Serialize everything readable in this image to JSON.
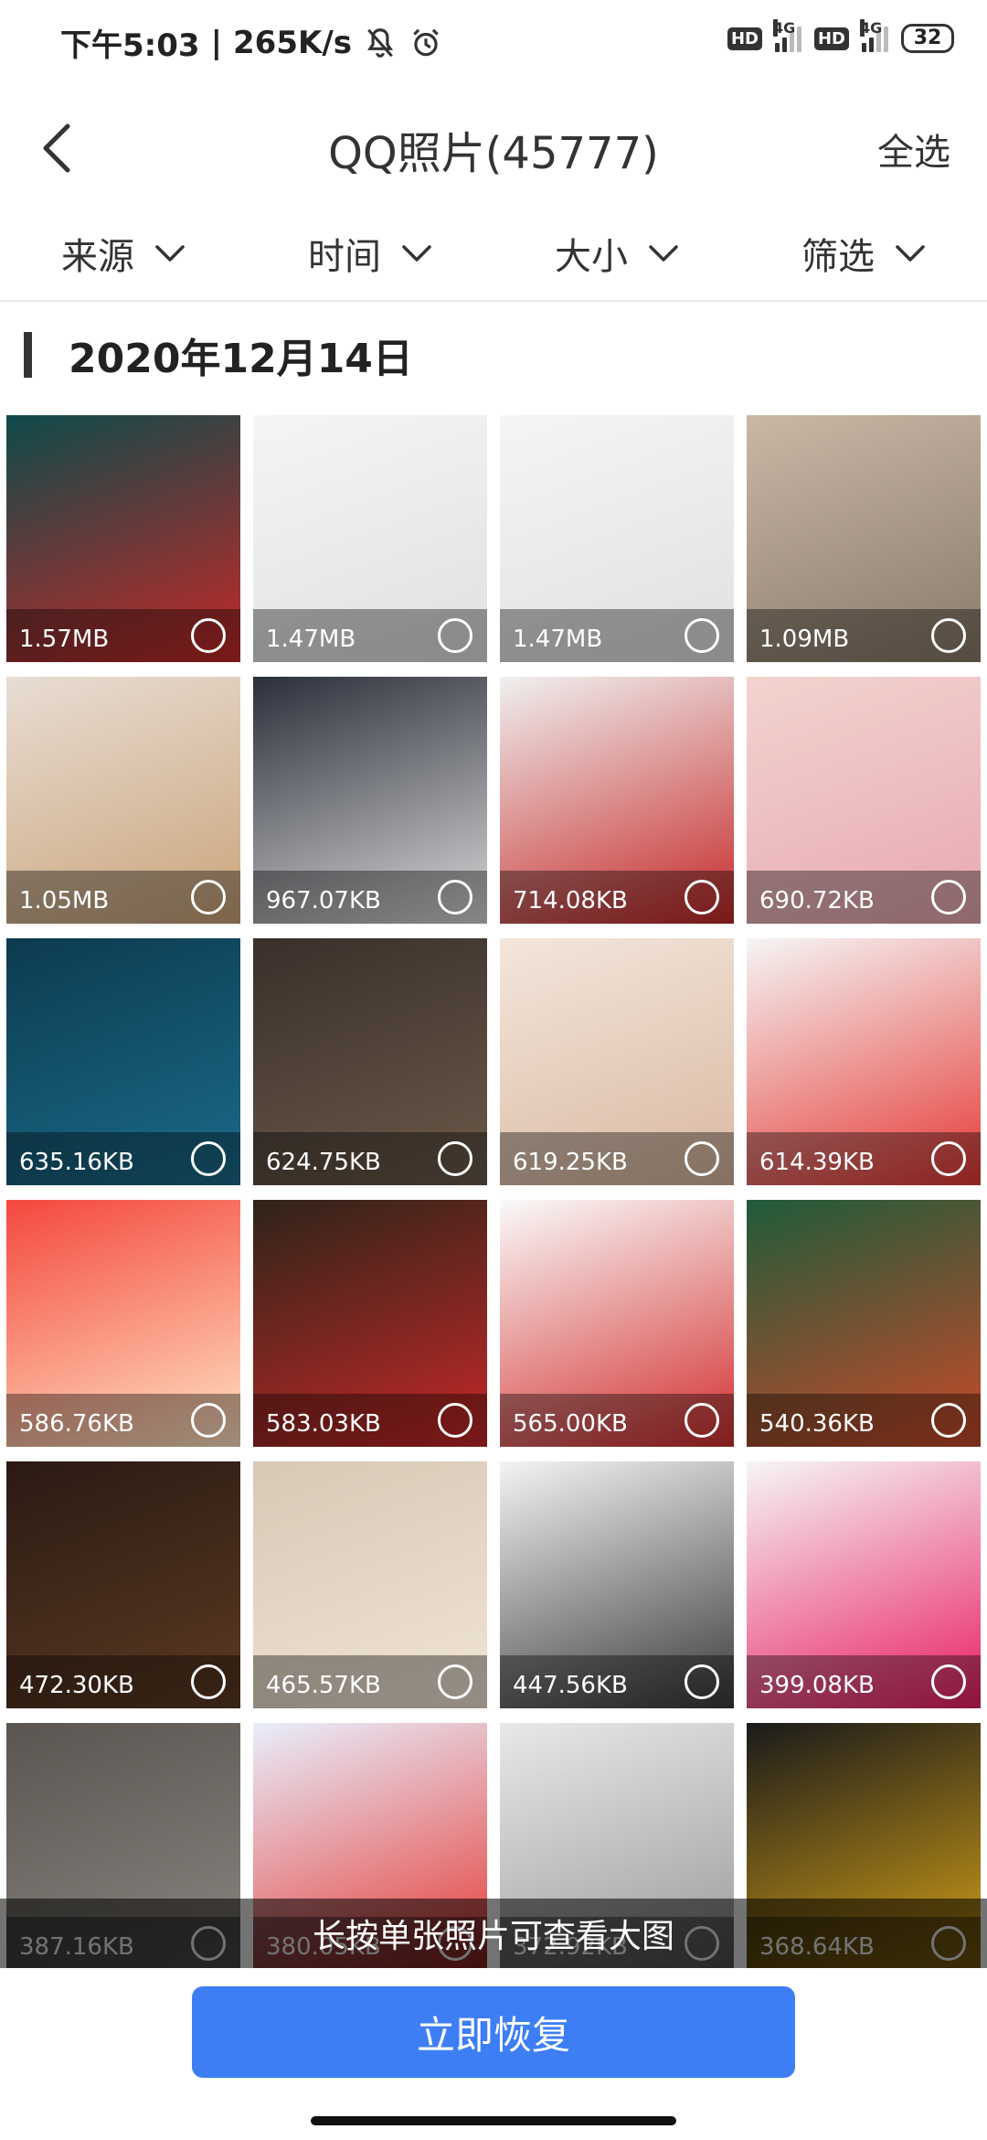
{
  "status_bar": {
    "time": "下午5:03",
    "separator": "|",
    "speed": "265K/s",
    "hd1": "HD",
    "sig1": "4G",
    "hd2": "HD",
    "sig2": "4G",
    "battery": "32"
  },
  "header": {
    "title": "QQ照片(45777)",
    "select_all": "全选"
  },
  "filters": [
    {
      "label": "来源"
    },
    {
      "label": "时间"
    },
    {
      "label": "大小"
    },
    {
      "label": "筛选"
    }
  ],
  "date_header": "2020年12月14日",
  "photos": [
    {
      "size": "1.57MB",
      "colors": [
        "#0e4a4a",
        "#c62828"
      ]
    },
    {
      "size": "1.47MB",
      "colors": [
        "#f5f5f5",
        "#e0e0e0"
      ]
    },
    {
      "size": "1.47MB",
      "colors": [
        "#f5f5f5",
        "#e0e0e0"
      ]
    },
    {
      "size": "1.09MB",
      "colors": [
        "#c9b8a6",
        "#8a7a6a"
      ]
    },
    {
      "size": "1.05MB",
      "colors": [
        "#e8ddd4",
        "#caa47a"
      ]
    },
    {
      "size": "967.07KB",
      "colors": [
        "#2b2f3a",
        "#d9d9d9"
      ]
    },
    {
      "size": "714.08KB",
      "colors": [
        "#f0f0f0",
        "#c62828"
      ]
    },
    {
      "size": "690.72KB",
      "colors": [
        "#f2d4cf",
        "#e8a8b0"
      ]
    },
    {
      "size": "635.16KB",
      "colors": [
        "#0d3b4f",
        "#1a6b8a"
      ]
    },
    {
      "size": "624.75KB",
      "colors": [
        "#3a2f2a",
        "#6b5a4a"
      ]
    },
    {
      "size": "619.25KB",
      "colors": [
        "#f3e6dc",
        "#d9b8a0"
      ]
    },
    {
      "size": "614.39KB",
      "colors": [
        "#f5f5f5",
        "#e53935"
      ]
    },
    {
      "size": "586.76KB",
      "colors": [
        "#f4473e",
        "#ffe3c2"
      ]
    },
    {
      "size": "583.03KB",
      "colors": [
        "#2e2419",
        "#c62828"
      ]
    },
    {
      "size": "565.00KB",
      "colors": [
        "#fafafa",
        "#d32f2f"
      ]
    },
    {
      "size": "540.36KB",
      "colors": [
        "#1f5b3a",
        "#c94a2a"
      ]
    },
    {
      "size": "472.30KB",
      "colors": [
        "#2a1a14",
        "#5c3a22"
      ]
    },
    {
      "size": "465.57KB",
      "colors": [
        "#d8c9b6",
        "#f0e4d4"
      ]
    },
    {
      "size": "447.56KB",
      "colors": [
        "#f4f4f4",
        "#3a3a3a"
      ]
    },
    {
      "size": "399.08KB",
      "colors": [
        "#f6f6f6",
        "#e91e63"
      ]
    },
    {
      "size": "387.16KB",
      "colors": [
        "#5a5550",
        "#8a8580"
      ]
    },
    {
      "size": "380.05KB",
      "colors": [
        "#e8eefc",
        "#e53935"
      ]
    },
    {
      "size": "372.92KB",
      "colors": [
        "#e8e8e8",
        "#9a9a9a"
      ]
    },
    {
      "size": "368.64KB",
      "colors": [
        "#1a1a1a",
        "#d4a017"
      ]
    }
  ],
  "toast": "长按单张照片可查看大图",
  "recover_button": "立即恢复",
  "accent_color": "#3d7ef5"
}
